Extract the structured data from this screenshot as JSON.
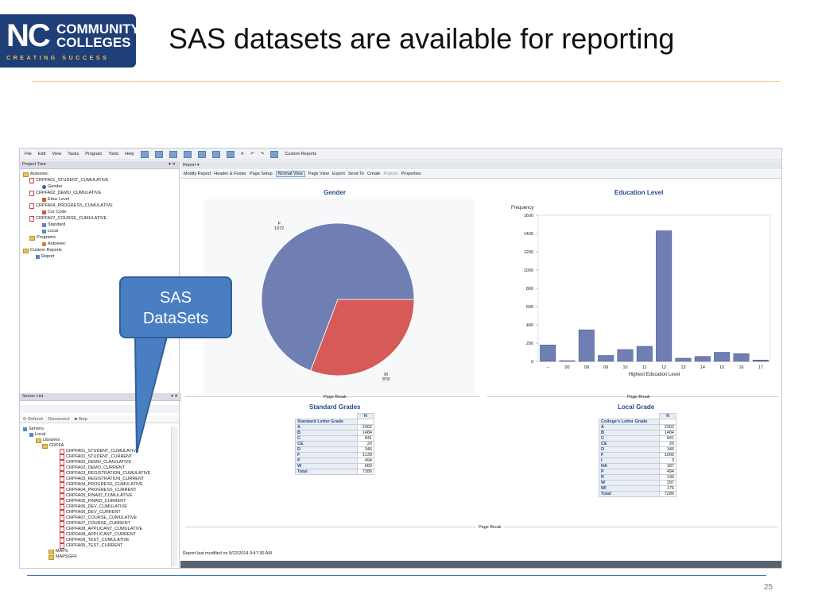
{
  "slide": {
    "logo_nc": "NC",
    "logo_community": "COMMUNITY",
    "logo_colleges": "COLLEGES",
    "logo_tagline": "CREATING SUCCESS",
    "title": "SAS datasets are available for reporting",
    "page_number": "25",
    "callout_line1": "SAS",
    "callout_line2": "DataSets"
  },
  "menu": [
    "File",
    "Edit",
    "View",
    "Tasks",
    "Program",
    "Tools",
    "Help"
  ],
  "toolbar": {
    "custom_reports": "Custom Reports"
  },
  "project_tree": {
    "header": "Project Tree",
    "items": [
      "Autoexec",
      "CRPFA01_STUDENT_CUMULATIVE",
      "Gender",
      "CRPFA02_DEMO_CUMULATIVE",
      "Educ Level",
      "CRPFA04_PROGRESS_CUMULATIVE",
      "Cur Code",
      "CRPFA07_COURSE_CUMULATIVE",
      "Standard",
      "Local",
      "Programs",
      "Autoexec",
      "Custom Reports",
      "Report"
    ]
  },
  "server_list": {
    "header": "Server List",
    "refresh": "Refresh",
    "disconnect": "Disconnect",
    "stop": "Stop",
    "items": [
      "Servers",
      "Local",
      "Libraries",
      "CRPFA",
      "CRPFA01_STUDENT_CUMULATIVE",
      "CRPFA01_STUDENT_CURRENT",
      "CRPFA02_DEMO_CUMULATIVE",
      "CRPFA02_DEMO_CURRENT",
      "CRPFA03_REGISTRATION_CUMULATIVE",
      "CRPFA03_REGISTRATION_CURRENT",
      "CRPFA04_PROGRESS_CUMULATIVE",
      "CRPFA04_PROGRESS_CURRENT",
      "CRPFA05_FINAID_CUMULATIVE",
      "CRPFA05_FINAID_CURRENT",
      "CRPFA06_DEV_CUMULATIVE",
      "CRPFA06_DEV_CURRENT",
      "CRPFA07_COURSE_CUMULATIVE",
      "CRPFA07_COURSE_CURRENT",
      "CRPFA08_APPLICANT_CUMULATIVE",
      "CRPFA08_APPLICANT_CURRENT",
      "CRPFA09_TEST_CUMULATIVE",
      "CRPFA09_TEST_CURRENT",
      "MAPS",
      "MAPSGFK"
    ]
  },
  "report": {
    "tab": "Report",
    "toolbar": [
      "Modify Report",
      "Header & Footer",
      "Page Setup",
      "Normal View",
      "Page View",
      "Export",
      "Send To",
      "Create",
      "Publish",
      "Properties"
    ],
    "status": "Report last modified on 8/22/2014 9:47:30 AM",
    "page_break": "Page Break"
  },
  "chart_data": [
    {
      "type": "pie",
      "title": "Gender",
      "categories": [
        "F",
        "M"
      ],
      "values": [
        1972,
        878
      ],
      "colors": [
        "#6f7fb4",
        "#d65a58"
      ]
    },
    {
      "type": "bar",
      "title": "Education Level",
      "ylabel": "Frequency",
      "xlabel": "Highest Education Level",
      "categories": [
        "--",
        "00",
        "08",
        "09",
        "10",
        "11",
        "12",
        "13",
        "14",
        "15",
        "16",
        "17"
      ],
      "values": [
        180,
        8,
        345,
        65,
        130,
        165,
        1430,
        35,
        55,
        100,
        85,
        15
      ],
      "ylim": [
        0,
        1600
      ],
      "yticks": [
        0,
        200,
        400,
        600,
        800,
        1000,
        1200,
        1400,
        1600
      ],
      "bar_color": "#6f7fb4"
    }
  ],
  "standard_grades": {
    "title": "Standard Grades",
    "column_header": "N",
    "row_header": "Standard Letter Grade",
    "rows": [
      [
        "A",
        "2302"
      ],
      [
        "B",
        "1484"
      ],
      [
        "C",
        "841"
      ],
      [
        "CE",
        "20"
      ],
      [
        "D",
        "346"
      ],
      [
        "F",
        "1139"
      ],
      [
        "P",
        "494"
      ],
      [
        "W",
        "660"
      ],
      [
        "Total",
        "7286"
      ]
    ]
  },
  "local_grade": {
    "title": "Local Grade",
    "column_header": "N",
    "row_header": "College's Letter Grade",
    "rows": [
      [
        "A",
        "2302"
      ],
      [
        "B",
        "1484"
      ],
      [
        "C",
        "841"
      ],
      [
        "CE",
        "20"
      ],
      [
        "D",
        "346"
      ],
      [
        "F",
        "1006"
      ],
      [
        "I",
        "3"
      ],
      [
        "NA",
        "187"
      ],
      [
        "P",
        "494"
      ],
      [
        "R",
        "130"
      ],
      [
        "W",
        "297"
      ],
      [
        "WI",
        "176"
      ],
      [
        "Total",
        "7286"
      ]
    ]
  }
}
